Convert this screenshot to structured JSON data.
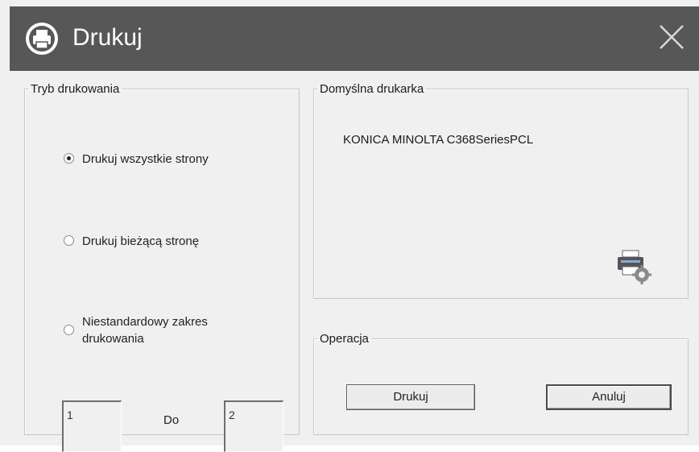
{
  "window": {
    "title": "Drukuj"
  },
  "print_mode": {
    "legend": "Tryb drukowania",
    "options": [
      {
        "label": "Drukuj wszystkie strony",
        "checked": true
      },
      {
        "label": "Drukuj bieżącą stronę",
        "checked": false
      },
      {
        "label": "Niestandardowy zakres drukowania",
        "checked": false
      }
    ],
    "range": {
      "from_value": "1",
      "to_label": "Do",
      "to_value": "2"
    }
  },
  "default_printer": {
    "legend": "Domyślna drukarka",
    "name": "KONICA MINOLTA C368SeriesPCL"
  },
  "operation": {
    "legend": "Operacja",
    "print_label": "Drukuj",
    "cancel_label": "Anuluj"
  },
  "colors": {
    "titlebar": "#575757",
    "dialog_bg": "#f0f0f0",
    "title_text": "#ffffff"
  },
  "icons": {
    "title_icon": "printer-icon",
    "close": "close-icon",
    "settings": "printer-settings-icon"
  }
}
